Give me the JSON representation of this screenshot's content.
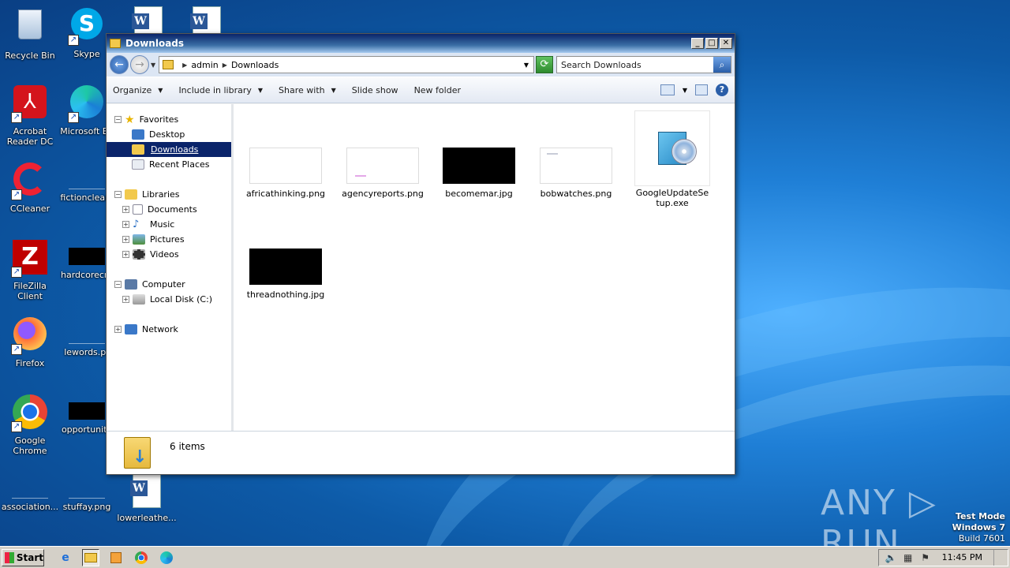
{
  "desktop": {
    "icons": [
      {
        "label": "Recycle Bin"
      },
      {
        "label": "Skype"
      },
      {
        "label": "Acrobat Reader DC"
      },
      {
        "label": "Microsoft Ed"
      },
      {
        "label": "CCleaner"
      },
      {
        "label": "fictionclean."
      },
      {
        "label": "FileZilla Client"
      },
      {
        "label": "hardcorecre"
      },
      {
        "label": "Firefox"
      },
      {
        "label": "lewords.pr"
      },
      {
        "label": "Google Chrome"
      },
      {
        "label": "opportunity"
      },
      {
        "label": "association..."
      },
      {
        "label": "stuffay.png"
      },
      {
        "label": "lowerleathe..."
      }
    ]
  },
  "window": {
    "title": "Downloads",
    "controls": {
      "minimize": "_",
      "maximize": "□",
      "close": "✕"
    }
  },
  "address": {
    "crumbs": [
      "admin",
      "Downloads"
    ],
    "search_placeholder": "Search Downloads"
  },
  "toolbar": {
    "organize": "Organize",
    "include": "Include in library",
    "share": "Share with",
    "slideshow": "Slide show",
    "newfolder": "New folder"
  },
  "nav": {
    "favorites": "Favorites",
    "desktop": "Desktop",
    "downloads": "Downloads",
    "recent": "Recent Places",
    "libraries": "Libraries",
    "documents": "Documents",
    "music": "Music",
    "pictures": "Pictures",
    "videos": "Videos",
    "computer": "Computer",
    "localdisk": "Local Disk (C:)",
    "network": "Network"
  },
  "files": [
    {
      "name": "africathinking.png"
    },
    {
      "name": "agencyreports.png"
    },
    {
      "name": "becomemar.jpg"
    },
    {
      "name": "bobwatches.png"
    },
    {
      "name": "GoogleUpdateSetup.exe"
    },
    {
      "name": "threadnothing.jpg"
    }
  ],
  "status": {
    "count": "6 items"
  },
  "watermark": "ANY ▷ RUN",
  "testmode": {
    "line1": "Test Mode",
    "line2": "Windows 7",
    "line3": "Build 7601"
  },
  "taskbar": {
    "start": "Start",
    "clock": "11:45 PM"
  }
}
